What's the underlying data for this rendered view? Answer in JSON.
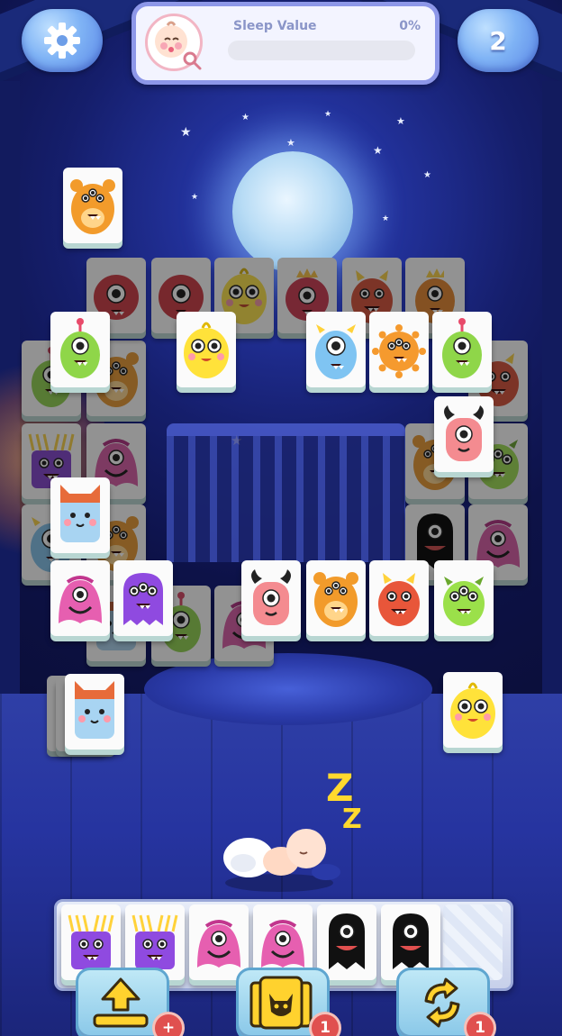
{
  "hud": {
    "sleep_label": "Sleep Value",
    "sleep_percent": "0%",
    "sleep_progress": 0,
    "level": "2"
  },
  "icons": {
    "settings": "gear-icon",
    "avatar": "baby-avatar-icon",
    "search": "magnifier-icon",
    "level": "level-bubble",
    "undo": "move-up-icon",
    "hint": "devil-tile-icon",
    "shuffle": "shuffle-arrows-icon"
  },
  "board": {
    "visible_tiles": [
      {
        "monster": "orange-bear",
        "state": "free"
      },
      {
        "monster": "red-fluffy",
        "state": "blocked"
      },
      {
        "monster": "yellow-chick",
        "state": "blocked"
      },
      {
        "monster": "red-crown",
        "state": "blocked"
      },
      {
        "monster": "red-horns",
        "state": "blocked"
      },
      {
        "monster": "orange-crown",
        "state": "blocked"
      },
      {
        "monster": "green-alien",
        "state": "free"
      },
      {
        "monster": "yellow-chick",
        "state": "free"
      },
      {
        "monster": "blue-cyclops",
        "state": "free"
      },
      {
        "monster": "orange-virus",
        "state": "free"
      },
      {
        "monster": "green-alien",
        "state": "free"
      },
      {
        "monster": "pink-horned-eye",
        "state": "free"
      },
      {
        "monster": "blue-cat",
        "state": "free"
      },
      {
        "monster": "purple-blob",
        "state": "free"
      },
      {
        "monster": "pink-cyclops",
        "state": "free"
      },
      {
        "monster": "pink-horned-eye",
        "state": "free"
      },
      {
        "monster": "orange-bear",
        "state": "free"
      },
      {
        "monster": "red-horns",
        "state": "free"
      },
      {
        "monster": "green-spiky",
        "state": "free"
      },
      {
        "monster": "blue-cat",
        "state": "free"
      },
      {
        "monster": "yellow-chick",
        "state": "free"
      }
    ]
  },
  "tray": {
    "slots": [
      "purple-spiky",
      "purple-spiky",
      "pink-cyclops",
      "pink-cyclops",
      "black-cyclops",
      "black-cyclops",
      ""
    ]
  },
  "powerups": {
    "undo": {
      "badge": "+"
    },
    "hint": {
      "badge": "1"
    },
    "shuffle": {
      "badge": "1"
    }
  },
  "scene": {
    "sleep_symbol": "Z"
  },
  "colors": {
    "tile_face": "#fbfbfb",
    "tile_edge": "#b8d6d2",
    "badge": "#e0504f",
    "hud_bubble": "#7fb3f5",
    "progress_track": "#e6e7f0"
  }
}
